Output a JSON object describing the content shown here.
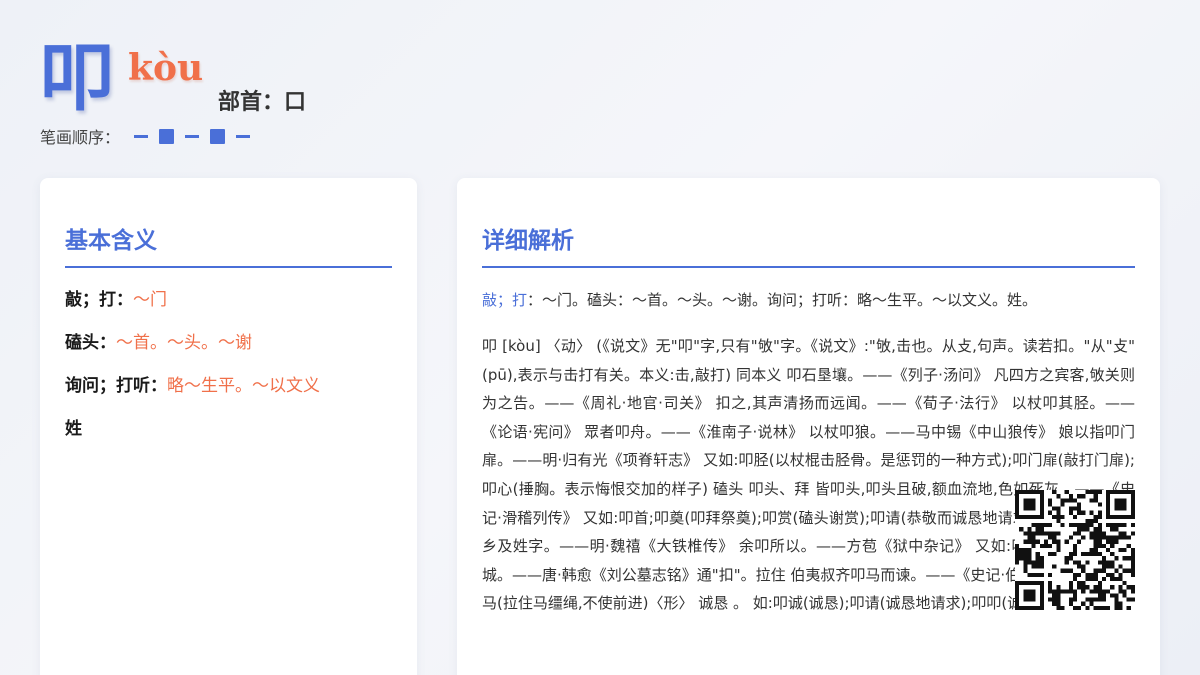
{
  "header": {
    "character": "叩",
    "pinyin": "kòu",
    "radical_label": "部首：",
    "radical": "口",
    "stroke_label": "笔画顺序：",
    "strokes": [
      "line",
      "box",
      "line",
      "box",
      "line"
    ]
  },
  "basic": {
    "title": "基本含义",
    "meanings": [
      {
        "label": "敲；打：",
        "example": "～门"
      },
      {
        "label": "磕头：",
        "example": "～首。～头。～谢"
      },
      {
        "label": "询问；打听：",
        "example": "略～生平。～以文义"
      },
      {
        "label": "姓",
        "example": ""
      }
    ]
  },
  "detail": {
    "title": "详细解析",
    "summary_label": "敲；打",
    "summary_text": "：～门。磕头：～首。～头。～谢。询问；打听：略～生平。～以文义。姓。",
    "body": "叩 [kòu] 〈动〉 (《说文》无\"叩\"字,只有\"敂\"字。《说文》:\"敂,击也。从攴,句声。读若扣。\"从\"攴\"(pū),表示与击打有关。本义:击,敲打) 同本义 叩石垦壤。——《列子·汤问》 凡四方之宾客,敂关则为之告。——《周礼·地官·司关》 扣之,其声清扬而远闻。——《荀子·法行》 以杖叩其胫。——《论语·宪问》 眾者叩舟。——《淮南子·说林》 以杖叩狼。——马中锡《中山狼传》 娘以指叩门扉。——明·归有光《项脊轩志》 又如:叩胫(以杖棍击胫骨。是惩罚的一种方式);叩门扉(敲打门扉);叩心(捶胸。表示悔恨交加的样子) 磕头 叩头、拜 皆叩头,叩头且破,额血流地,色如死灰。——《史记·滑稽列传》 又如:叩首;叩奠(叩拜祭奠);叩赏(磕头谢赏);叩请(恭敬而诚恳地请求)举发;询问 扣其乡及姓字。——明·魏禧《大铁椎传》 余叩所以。——方苞《狱中杂记》 又如:叩咨;叩问 拉住 叩城。——唐·韩愈《刘公墓志铭》通\"扣\"。拉住 伯夷叔齐叩马而谏。——《史记·伯夷列传》 又如:叩马(拉住马缰绳,不使前进)〈形〉 诚恳 。 如:叩诚(诚恳);叩请(诚恳地请求);叩叩(诚恳)"
  },
  "watermark": "叩",
  "colors": {
    "accent": "#4a6fd8",
    "highlight": "#f0704a",
    "card": "#ffffff",
    "background": "#f0f2f7"
  },
  "qr_icon": "qr-code-icon"
}
